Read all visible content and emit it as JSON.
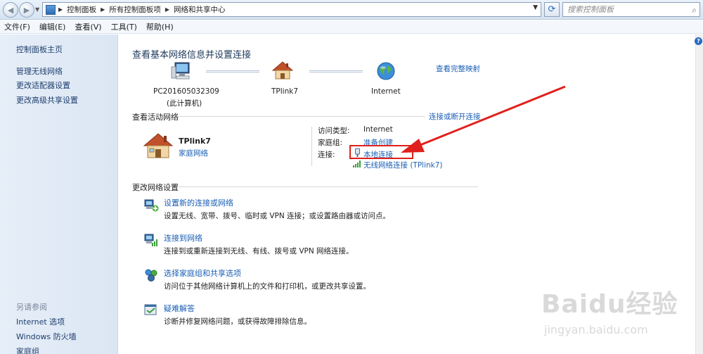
{
  "address_bar": {
    "breadcrumbs": [
      "控制面板",
      "所有控制面板项",
      "网络和共享中心"
    ],
    "search_placeholder": "搜索控制面板"
  },
  "menu": [
    "文件(F)",
    "编辑(E)",
    "查看(V)",
    "工具(T)",
    "帮助(H)"
  ],
  "sidebar": {
    "home": "控制面板主页",
    "links": [
      "管理无线网络",
      "更改适配器设置",
      "更改高级共享设置"
    ],
    "see_also_title": "另请参阅",
    "see_also": [
      "Internet 选项",
      "Windows 防火墙",
      "家庭组"
    ]
  },
  "main": {
    "title": "查看基本网络信息并设置连接",
    "view_full_map": "查看完整映射",
    "map": {
      "computer_name": "PC201605032309",
      "computer_note": "(此计算机)",
      "network_name": "TPlink7",
      "internet": "Internet"
    },
    "active_networks_title": "查看活动网络",
    "connect_disconnect": "连接或断开连接",
    "active_network": {
      "name": "TPlink7",
      "type": "家庭网络",
      "access_type_label": "访问类型:",
      "access_type_value": "Internet",
      "homegroup_label": "家庭组:",
      "homegroup_value": "准备创建",
      "connections_label": "连接:",
      "connection_1": "本地连接",
      "connection_2": "无线网络连接 (TPlink7)"
    },
    "change_settings_title": "更改网络设置",
    "tasks": [
      {
        "title": "设置新的连接或网络",
        "desc": "设置无线、宽带、拨号、临时或 VPN 连接；或设置路由器或访问点。"
      },
      {
        "title": "连接到网络",
        "desc": "连接到或重新连接到无线、有线、拨号或 VPN 网络连接。"
      },
      {
        "title": "选择家庭组和共享选项",
        "desc": "访问位于其他网络计算机上的文件和打印机，或更改共享设置。"
      },
      {
        "title": "疑难解答",
        "desc": "诊断并修复网络问题，或获得故障排除信息。"
      }
    ]
  },
  "watermark": {
    "brand": "Baidu经验",
    "url": "jingyan.baidu.com"
  },
  "colors": {
    "link": "#1a5fb4",
    "annotation": "#e0201c",
    "sidebar": "#dbe6f3"
  }
}
